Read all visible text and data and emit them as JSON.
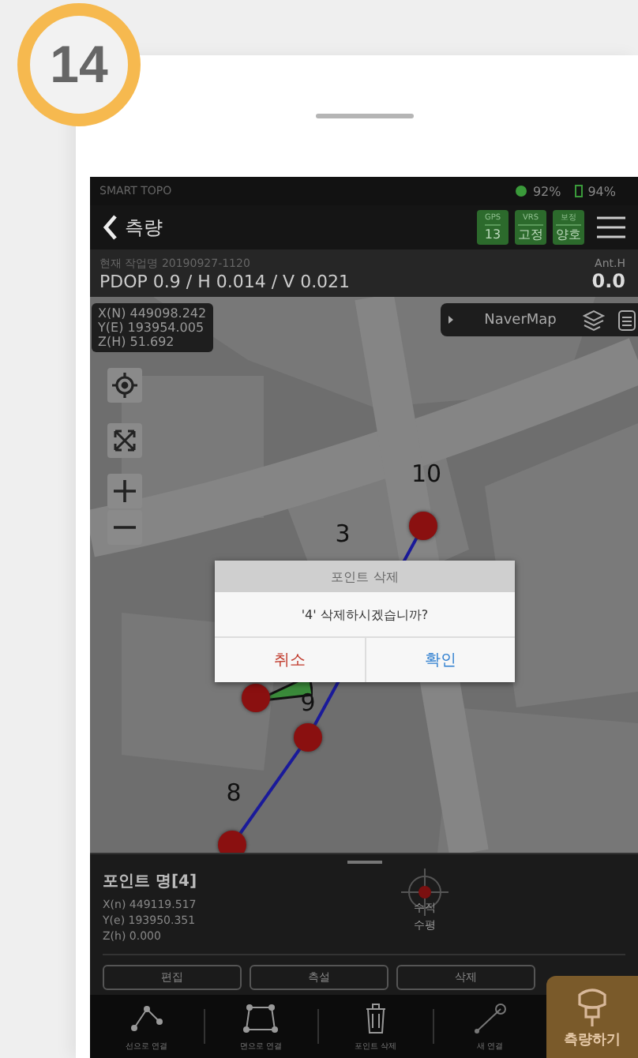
{
  "step_badge": "14",
  "status_bar": {
    "app_name": "SMART TOPO",
    "signal": "92%",
    "battery": "94%"
  },
  "header": {
    "back_label": "측량",
    "badges": [
      {
        "label": "GPS",
        "value": "13"
      },
      {
        "label": "VRS",
        "value": "고정"
      },
      {
        "label": "보정",
        "value": "양호"
      }
    ]
  },
  "info_bar": {
    "job": "현재 작업명 20190927-1120",
    "precision": "PDOP 0.9 / H 0.014 / V 0.021",
    "ant_label": "Ant.H",
    "ant_value": "0.0"
  },
  "map": {
    "coordinates": [
      "X(N) 449098.242",
      "Y(E) 193954.005",
      "Z(H) 51.692"
    ],
    "layer": "NaverMap",
    "points": [
      {
        "label": "10"
      },
      {
        "label": "3"
      },
      {
        "label": "9"
      },
      {
        "label": "8"
      }
    ]
  },
  "dialog": {
    "title": "포인트 삭제",
    "message": "'4' 삭제하시겠습니까?",
    "buttons": [
      {
        "label": "취소",
        "kind": "cancel"
      },
      {
        "label": "확인",
        "kind": "confirm"
      }
    ]
  },
  "panel": {
    "point_name": "포인트 명[4]",
    "coordinates": [
      "X(n) 449119.517",
      "Y(e) 193950.351",
      "Z(h) 0.000"
    ],
    "axes": [
      "수직",
      "수평"
    ],
    "buttons": [
      "편집",
      "측설",
      "삭제"
    ]
  },
  "toolbar": {
    "items": [
      {
        "label": "선으로 연결",
        "kind": "polyline"
      },
      {
        "label": "면으로 연결",
        "kind": "polygon"
      },
      {
        "label": "포인트 삭제",
        "kind": "trash"
      },
      {
        "label": "새 연결",
        "kind": "line"
      }
    ],
    "primary": "측량하기"
  }
}
